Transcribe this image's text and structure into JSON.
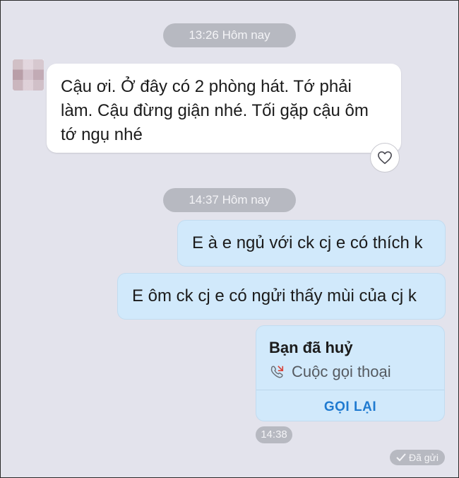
{
  "timestamps": {
    "first": "13:26 Hôm nay",
    "second": "14:37 Hôm nay",
    "call_time": "14:38"
  },
  "incoming_message": {
    "lines": [
      "Cậu ơi. Ở đây có 2 phòng hát. Tớ phải",
      "làm. Cậu đừng giận nhé. Tối gặp cậu ôm",
      "tớ ngụ nhé"
    ],
    "reaction_icon": "heart-icon"
  },
  "outgoing_messages": [
    "E à e ngủ với ck cj e có thích k",
    "E ôm ck cj e có ngửi thấy mùi của cj k"
  ],
  "call_card": {
    "title": "Bạn đã huỷ",
    "subtitle": "Cuộc gọi thoại",
    "action": "GỌI LẠI",
    "icon": "missed-call-icon"
  },
  "status": {
    "label": "Đã gửi",
    "icon": "check-icon"
  },
  "colors": {
    "background": "#e3e3ec",
    "outgoing_bubble": "#d1e9fb",
    "incoming_bubble": "#ffffff",
    "pill": "#b7b9c1",
    "call_action": "#1f7ad0",
    "missed_call": "#d9453b"
  }
}
